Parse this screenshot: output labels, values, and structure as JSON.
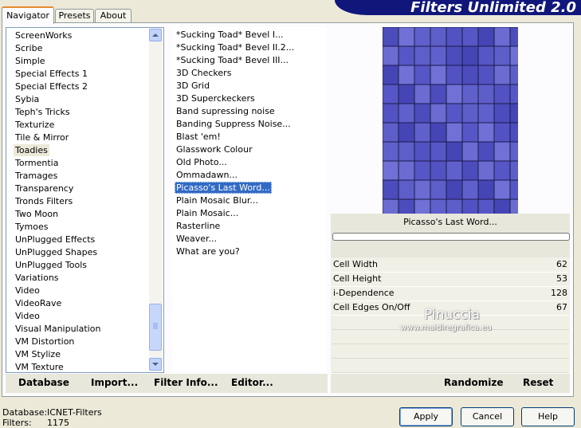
{
  "header": {
    "title": "Filters Unlimited 2.0"
  },
  "tabs": [
    {
      "label": "Navigator",
      "active": true
    },
    {
      "label": "Presets",
      "active": false
    },
    {
      "label": "About",
      "active": false
    }
  ],
  "categories": {
    "selected": "Toadies",
    "items": [
      "ScreenWorks",
      "Scribe",
      "Simple",
      "Special Effects 1",
      "Special Effects 2",
      "Sybia",
      "Teph's Tricks",
      "Texturize",
      "Tile & Mirror",
      "Toadies",
      "Tormentia",
      "Tramages",
      "Transparency",
      "Tronds Filters",
      "Two Moon",
      "Tymoes",
      "UnPlugged Effects",
      "UnPlugged Shapes",
      "UnPlugged Tools",
      "Variations",
      "Video",
      "VideoRave",
      "Video",
      "Visual Manipulation",
      "VM Distortion",
      "VM Stylize",
      "VM Texture"
    ]
  },
  "filters": {
    "selected": "Picasso's Last Word...",
    "items": [
      "*Sucking Toad*  Bevel I...",
      "*Sucking Toad*  Bevel II.2...",
      "*Sucking Toad*  Bevel III...",
      "3D Checkers",
      "3D Grid",
      "3D Superckeckers",
      "Band supressing noise",
      "Banding Suppress Noise...",
      "Blast 'em!",
      "Glasswork Colour",
      "Old Photo...",
      "Ommadawn...",
      "Picasso's Last Word...",
      "Plain Mosaic Blur...",
      "Plain Mosaic...",
      "Rasterline",
      "Weaver...",
      "What are you?"
    ]
  },
  "preview": {
    "filter_name": "Picasso's Last Word...",
    "base_color": "#5a5ac8",
    "progress": 0
  },
  "parameters": [
    {
      "label": "Cell Width",
      "value": "62"
    },
    {
      "label": "Cell Height",
      "value": "53"
    },
    {
      "label": "i-Dependence",
      "value": "128"
    },
    {
      "label": "Cell Edges On/Off",
      "value": "67"
    }
  ],
  "watermark": {
    "line1": "Pinuccia",
    "line2": "www.maidiregrafica.eu"
  },
  "bottom_bar": {
    "database": "Database",
    "import": "Import...",
    "filter_info": "Filter Info...",
    "editor": "Editor...",
    "randomize": "Randomize",
    "reset": "Reset"
  },
  "status": {
    "database_label": "Database:",
    "database_value": "ICNET-Filters",
    "filters_label": "Filters:",
    "filters_value": "1175"
  },
  "dialog_buttons": {
    "apply": "Apply",
    "cancel": "Cancel",
    "help": "Help"
  },
  "icons": {
    "scroll_up": "triangle-up",
    "scroll_down": "triangle-down"
  }
}
